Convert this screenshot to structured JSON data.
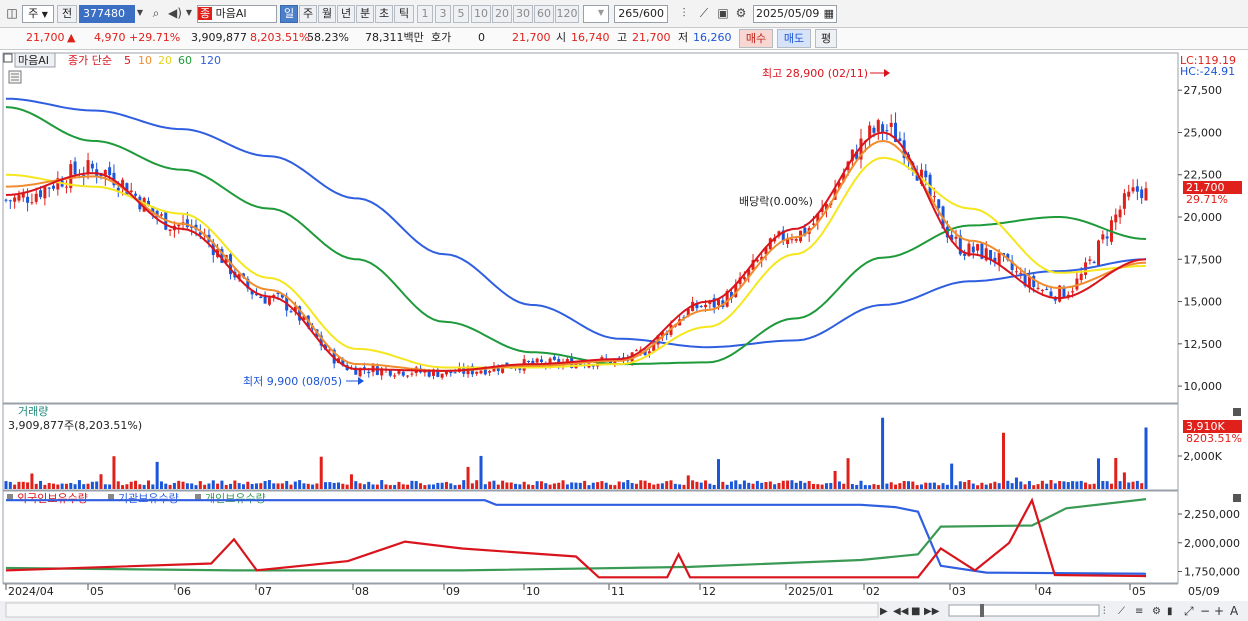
{
  "toolbar": {
    "mode": "주",
    "prev_label": "전",
    "code": "377480",
    "stock_name_tag": "종",
    "stock_name": "마음AI",
    "periods": [
      "일",
      "주",
      "월",
      "년",
      "분",
      "초",
      "틱"
    ],
    "active_period": "일",
    "intervals": [
      "1",
      "3",
      "5",
      "10",
      "20",
      "30",
      "60",
      "120"
    ],
    "count": "265",
    "count_total": "/600",
    "date": "2025/05/09"
  },
  "quote": {
    "price": "21,700",
    "change": "4,970",
    "change_pct": "+29.71%",
    "volume": "3,909,877",
    "volume_ratio": "8,203.51%",
    "turnover": "58.23%",
    "amount": "78,311백만",
    "hoga_label": "호가",
    "hoga": "0",
    "hoga_price": "21,700",
    "open_label": "시",
    "open": "16,740",
    "high_label": "고",
    "high": "21,700",
    "low_label": "저",
    "low": "16,260",
    "buy_label": "매수",
    "sell_label": "매도",
    "eval_label": "평"
  },
  "price_panel": {
    "name_tag": "마음AI",
    "ma_title": "종가 단순",
    "ma_periods": [
      "5",
      "10",
      "20",
      "60",
      "120"
    ],
    "lc": "LC:119.19",
    "hc": "HC:-24.91",
    "high_annotation": "최고 28,900 (02/11)",
    "low_annotation": "최저 9,900 (08/05)",
    "dividend_annotation": "배당락(0.00%)",
    "last_price_tag": "21,700",
    "last_change_tag": "29.71%"
  },
  "volume_panel": {
    "title": "거래량",
    "value": "3,909,877주(8,203.51%)",
    "last_tag": "3,910K",
    "last_pct": "8203.51%"
  },
  "holdings_panel": {
    "legends": [
      "외국인보유수량",
      "기관보유수량",
      "개인보유수량"
    ]
  },
  "x_axis_labels": [
    "2024/04",
    "05",
    "06",
    "07",
    "08",
    "09",
    "10",
    "11",
    "12",
    "2025/01",
    "02",
    "03",
    "04",
    "05",
    "05/09"
  ],
  "colors": {
    "up": "#e0201a",
    "down": "#1b55d8",
    "ma5": "#d9141c",
    "ma10": "#f08c2c",
    "ma20": "#f5e61e",
    "ma60": "#1e9a3a",
    "ma120": "#2f5fe0",
    "foreign": "#d9141c",
    "institution": "#2f5fe0",
    "individual": "#3a9a55"
  },
  "chart_data": [
    {
      "type": "candlestick",
      "title": "마음AI",
      "x": [
        "2024/04",
        "05",
        "06",
        "07",
        "08",
        "09",
        "10",
        "11",
        "12",
        "2025/01",
        "02",
        "03",
        "04",
        "05"
      ],
      "close": [
        21000,
        22800,
        19500,
        15200,
        11000,
        10800,
        11300,
        11500,
        14800,
        19000,
        25200,
        18000,
        15500,
        21700
      ],
      "y_ticks": [
        "27,500",
        "25,000",
        "22,500",
        "20,000",
        "17,500",
        "15,000",
        "12,500",
        "10,000"
      ],
      "ylim": [
        9000,
        29700
      ],
      "series": [
        {
          "name": "5",
          "values": [
            21300,
            22600,
            19300,
            15300,
            11000,
            10900,
            11300,
            11600,
            15000,
            19300,
            25000,
            17800,
            15200,
            17500
          ]
        },
        {
          "name": "10",
          "values": [
            21800,
            22400,
            19600,
            15700,
            11300,
            10900,
            11200,
            11500,
            14500,
            18800,
            24500,
            18600,
            15800,
            17300
          ]
        },
        {
          "name": "20",
          "values": [
            22500,
            21800,
            20200,
            16400,
            12200,
            11100,
            11100,
            11300,
            13500,
            17800,
            23500,
            20500,
            16700,
            17100
          ]
        },
        {
          "name": "60",
          "values": [
            26500,
            24500,
            22800,
            20500,
            17500,
            13800,
            12000,
            11300,
            11400,
            14000,
            17600,
            19500,
            20000,
            18700
          ]
        },
        {
          "name": "120",
          "values": [
            27000,
            26300,
            25200,
            23600,
            21100,
            17800,
            14800,
            12800,
            12300,
            12700,
            14800,
            16200,
            16800,
            17500
          ]
        }
      ],
      "annotations": [
        "최고 28,900 (02/11)",
        "최저 9,900 (08/05)",
        "배당락(0.00%)"
      ]
    },
    {
      "type": "bar",
      "title": "거래량",
      "y_ticks": [
        "2,000K"
      ],
      "last_value": "3,910K"
    },
    {
      "type": "line",
      "y_ticks": [
        "2,250,000",
        "2,000,000",
        "1,750,000"
      ],
      "series": [
        {
          "name": "외국인보유수량"
        },
        {
          "name": "기관보유수량"
        },
        {
          "name": "개인보유수량"
        }
      ]
    }
  ]
}
